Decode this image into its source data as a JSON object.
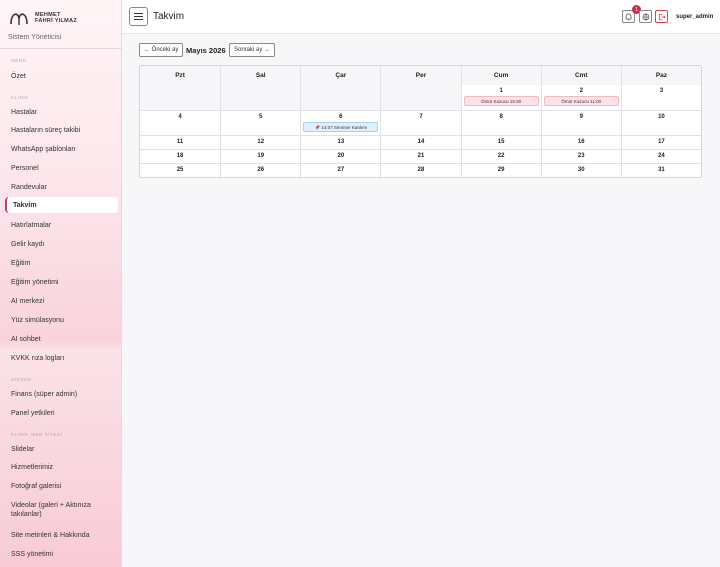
{
  "brand": {
    "line1": "MEHMET",
    "line2": "FAHRİ YILMAZ"
  },
  "role": "Sistem Yöneticisi",
  "sidebar": {
    "sections": [
      {
        "label": "MENÜ"
      },
      {
        "label": "KLİNİK"
      },
      {
        "label": "SİSTEM"
      },
      {
        "label": "KLİNİK WEB SİTESİ"
      }
    ],
    "items": [
      {
        "label": "Özet"
      },
      {
        "label": "Hastalar"
      },
      {
        "label": "Hastaların süreç takibi"
      },
      {
        "label": "WhatsApp şablonları"
      },
      {
        "label": "Personel"
      },
      {
        "label": "Randevular"
      },
      {
        "label": "Takvim",
        "active": true
      },
      {
        "label": "Hatırlatmalar"
      },
      {
        "label": "Gelir kaydı"
      },
      {
        "label": "Eğitim"
      },
      {
        "label": "Eğitim yönetimi"
      },
      {
        "label": "AI merkezi"
      },
      {
        "label": "Yüz simülasyonu"
      },
      {
        "label": "AI sohbet"
      },
      {
        "label": "KVKK rıza logları"
      },
      {
        "label": "Finans (süper admin)"
      },
      {
        "label": "Panel yetkileri"
      },
      {
        "label": "Slidelar"
      },
      {
        "label": "Hizmetlerimiz"
      },
      {
        "label": "Fotoğraf galerisi"
      },
      {
        "label": "Videolar (galeri + Aktınıza takılanlar)"
      },
      {
        "label": "Site metinleri & Hakkında"
      },
      {
        "label": "SSS yönetimi"
      }
    ]
  },
  "topbar": {
    "title": "Takvim",
    "notification_count": "1",
    "user": "super_admin",
    "icons": {
      "bell": "bell-icon",
      "globe": "globe-icon",
      "logout": "logout-icon",
      "menu": "hamburger-icon"
    }
  },
  "controls": {
    "prev_label": "← Önceki ay",
    "month": "Mayıs 2026",
    "next_label": "Sonraki ay →"
  },
  "calendar": {
    "weekdays": [
      "Pzt",
      "Sal",
      "Çar",
      "Per",
      "Cum",
      "Cmt",
      "Paz"
    ],
    "weeks": [
      [
        {
          "day": "",
          "events": []
        },
        {
          "day": "",
          "events": []
        },
        {
          "day": "",
          "events": []
        },
        {
          "day": "",
          "events": []
        },
        {
          "day": "1",
          "events": [
            {
              "text": "Ömür Kuzucu 16:30",
              "color": "pink"
            }
          ]
        },
        {
          "day": "2",
          "events": [
            {
              "text": "Ömür Kuzucu 11:00",
              "color": "pink"
            }
          ]
        },
        {
          "day": "3",
          "events": []
        }
      ],
      [
        {
          "day": "4",
          "events": []
        },
        {
          "day": "5",
          "events": []
        },
        {
          "day": "6",
          "events": [
            {
              "text": "📌 14:07 Seminer Katılımı",
              "color": "blue"
            }
          ]
        },
        {
          "day": "7",
          "events": []
        },
        {
          "day": "8",
          "events": []
        },
        {
          "day": "9",
          "events": []
        },
        {
          "day": "10",
          "events": []
        }
      ],
      [
        {
          "day": "11",
          "events": []
        },
        {
          "day": "12",
          "events": []
        },
        {
          "day": "13",
          "events": []
        },
        {
          "day": "14",
          "events": []
        },
        {
          "day": "15",
          "events": []
        },
        {
          "day": "16",
          "events": []
        },
        {
          "day": "17",
          "events": []
        }
      ],
      [
        {
          "day": "18",
          "events": []
        },
        {
          "day": "19",
          "events": []
        },
        {
          "day": "20",
          "events": []
        },
        {
          "day": "21",
          "events": []
        },
        {
          "day": "22",
          "events": []
        },
        {
          "day": "23",
          "events": []
        },
        {
          "day": "24",
          "events": []
        }
      ],
      [
        {
          "day": "25",
          "events": []
        },
        {
          "day": "26",
          "events": []
        },
        {
          "day": "27",
          "events": []
        },
        {
          "day": "28",
          "events": []
        },
        {
          "day": "29",
          "events": []
        },
        {
          "day": "30",
          "events": []
        },
        {
          "day": "31",
          "events": []
        }
      ]
    ]
  }
}
